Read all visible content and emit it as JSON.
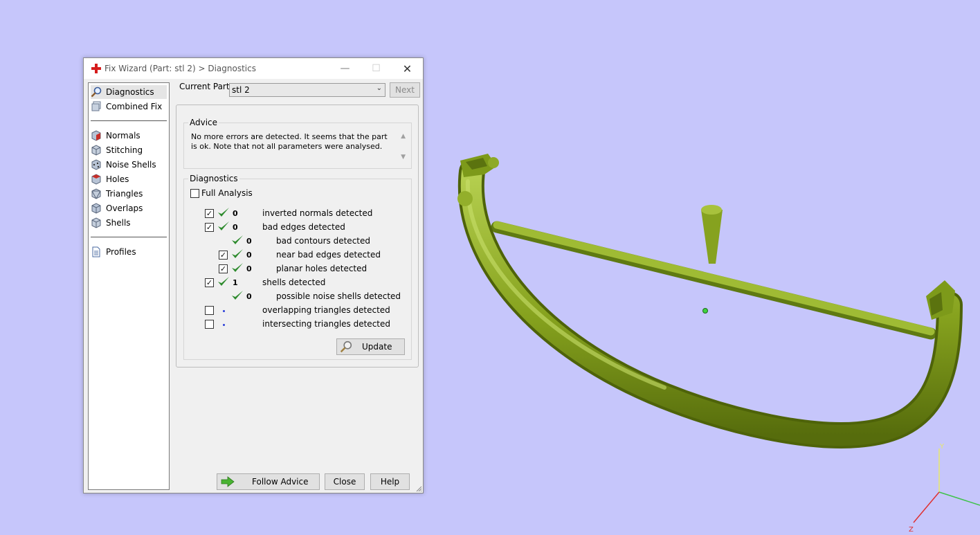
{
  "window": {
    "title": "Fix Wizard (Part: stl 2) > Diagnostics",
    "minimize_glyph": "—",
    "maximize_glyph": "☐",
    "close_glyph": "✕"
  },
  "sidebar": {
    "items": [
      {
        "label": "Diagnostics",
        "icon": "magnifier-icon",
        "selected": true
      },
      {
        "label": "Combined Fix",
        "icon": "combined-fix-icon"
      },
      {
        "label": "Normals",
        "icon": "normals-cube-icon"
      },
      {
        "label": "Stitching",
        "icon": "stitching-cube-icon"
      },
      {
        "label": "Noise Shells",
        "icon": "noise-shells-cube-icon"
      },
      {
        "label": "Holes",
        "icon": "holes-cube-icon"
      },
      {
        "label": "Triangles",
        "icon": "triangles-cube-icon"
      },
      {
        "label": "Overlaps",
        "icon": "overlaps-cube-icon"
      },
      {
        "label": "Shells",
        "icon": "shells-cube-icon"
      },
      {
        "label": "Profiles",
        "icon": "document-icon"
      }
    ]
  },
  "current_part": {
    "label": "Current Part:",
    "value": "stl 2",
    "next_label": "Next"
  },
  "advice": {
    "title": "Advice",
    "text": "No more errors are detected. It seems that the part is ok. Note that not all parameters were analysed."
  },
  "diagnostics": {
    "title": "Diagnostics",
    "full_analysis_label": "Full Analysis",
    "rows": [
      {
        "checkbox": true,
        "checked": true,
        "status": "ok",
        "count": "0",
        "label": "inverted normals detected",
        "indent": 0
      },
      {
        "checkbox": true,
        "checked": true,
        "status": "ok",
        "count": "0",
        "label": "bad edges detected",
        "indent": 0
      },
      {
        "checkbox": false,
        "checked": false,
        "status": "ok",
        "count": "0",
        "label": "bad contours detected",
        "indent": 1
      },
      {
        "checkbox": true,
        "checked": true,
        "status": "ok",
        "count": "0",
        "label": "near bad edges detected",
        "indent": 1
      },
      {
        "checkbox": true,
        "checked": true,
        "status": "ok",
        "count": "0",
        "label": "planar holes detected",
        "indent": 1
      },
      {
        "checkbox": true,
        "checked": true,
        "status": "ok",
        "count": "1",
        "label": "shells detected",
        "indent": 0
      },
      {
        "checkbox": false,
        "checked": false,
        "status": "ok",
        "count": "0",
        "label": "possible noise shells detected",
        "indent": 1
      },
      {
        "checkbox": true,
        "checked": false,
        "status": "pending",
        "count": "",
        "label": "overlapping triangles detected",
        "indent": 0
      },
      {
        "checkbox": true,
        "checked": false,
        "status": "pending",
        "count": "",
        "label": "intersecting triangles detected",
        "indent": 0
      }
    ],
    "update_label": "Update"
  },
  "footer": {
    "follow_advice_label": "Follow Advice",
    "close_label": "Close",
    "help_label": "Help"
  },
  "viewport": {
    "background": "#c6c6fb",
    "part_color": "#9ab52c",
    "axis_labels": {
      "y": "Y",
      "z": "Z"
    }
  }
}
